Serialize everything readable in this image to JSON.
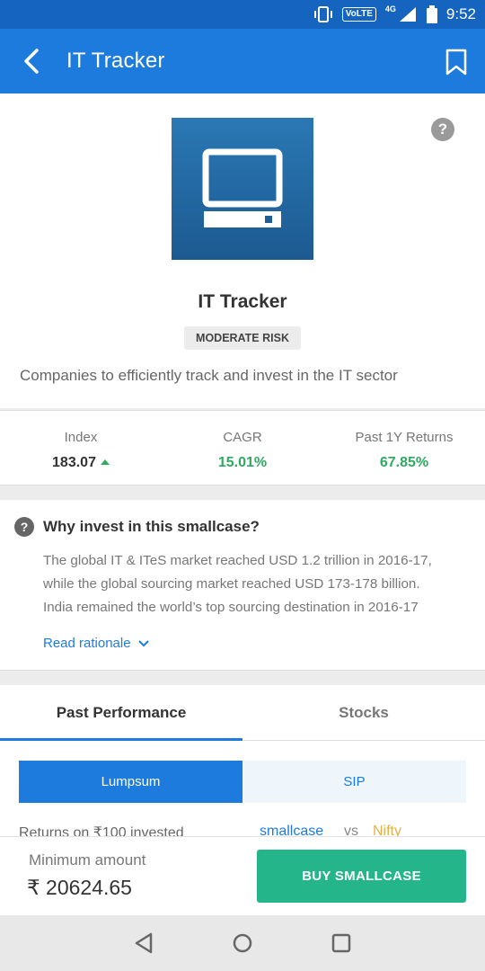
{
  "status_bar": {
    "volte": "VoLTE",
    "network": "4G",
    "time": "9:52"
  },
  "header": {
    "title": "IT Tracker"
  },
  "smallcase": {
    "name": "IT Tracker",
    "risk": "MODERATE RISK",
    "description": "Companies to efficiently track and invest in the IT sector"
  },
  "stats": {
    "index": {
      "label": "Index",
      "value": "183.07"
    },
    "cagr": {
      "label": "CAGR",
      "value": "15.01%"
    },
    "returns": {
      "label": "Past 1Y Returns",
      "value": "67.85%"
    }
  },
  "why": {
    "title": "Why invest in this smallcase?",
    "lines": [
      "The global IT & ITeS market reached USD 1.2 trillion in 2016-17,",
      "while the global sourcing market reached USD 173-178 billion.",
      "India remained the world’s top sourcing destination in 2016-17"
    ],
    "read_more": "Read rationale"
  },
  "tabs": [
    {
      "label": "Past Performance"
    },
    {
      "label": "Stocks"
    }
  ],
  "segment": {
    "lumpsum": "Lumpsum",
    "sip": "SIP"
  },
  "returns_row": {
    "label": "Returns on ₹100 invested",
    "smallcase": "smallcase",
    "vs": "vs",
    "nifty": "Nifty"
  },
  "buy_bar": {
    "min_label": "Minimum amount",
    "min_value": "₹ 20624.65",
    "button": "BUY SMALLCASE"
  },
  "colors": {
    "primary": "#1e7bde",
    "positive": "#2eaa62",
    "buy": "#24b58a",
    "nifty": "#e0b04a"
  }
}
